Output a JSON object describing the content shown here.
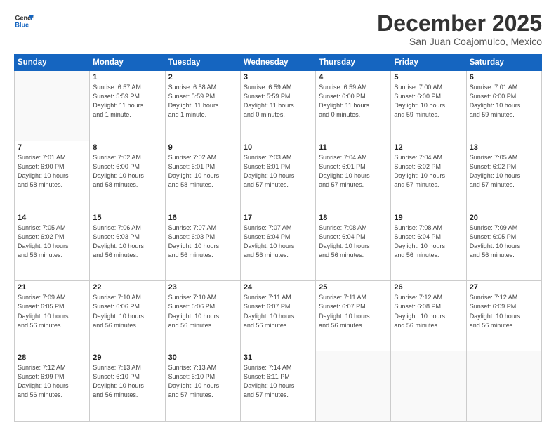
{
  "logo": {
    "line1": "General",
    "line2": "Blue"
  },
  "title": "December 2025",
  "location": "San Juan Coajomulco, Mexico",
  "days_header": [
    "Sunday",
    "Monday",
    "Tuesday",
    "Wednesday",
    "Thursday",
    "Friday",
    "Saturday"
  ],
  "weeks": [
    [
      {
        "day": "",
        "info": ""
      },
      {
        "day": "1",
        "info": "Sunrise: 6:57 AM\nSunset: 5:59 PM\nDaylight: 11 hours\nand 1 minute."
      },
      {
        "day": "2",
        "info": "Sunrise: 6:58 AM\nSunset: 5:59 PM\nDaylight: 11 hours\nand 1 minute."
      },
      {
        "day": "3",
        "info": "Sunrise: 6:59 AM\nSunset: 5:59 PM\nDaylight: 11 hours\nand 0 minutes."
      },
      {
        "day": "4",
        "info": "Sunrise: 6:59 AM\nSunset: 6:00 PM\nDaylight: 11 hours\nand 0 minutes."
      },
      {
        "day": "5",
        "info": "Sunrise: 7:00 AM\nSunset: 6:00 PM\nDaylight: 10 hours\nand 59 minutes."
      },
      {
        "day": "6",
        "info": "Sunrise: 7:01 AM\nSunset: 6:00 PM\nDaylight: 10 hours\nand 59 minutes."
      }
    ],
    [
      {
        "day": "7",
        "info": "Sunrise: 7:01 AM\nSunset: 6:00 PM\nDaylight: 10 hours\nand 58 minutes."
      },
      {
        "day": "8",
        "info": "Sunrise: 7:02 AM\nSunset: 6:00 PM\nDaylight: 10 hours\nand 58 minutes."
      },
      {
        "day": "9",
        "info": "Sunrise: 7:02 AM\nSunset: 6:01 PM\nDaylight: 10 hours\nand 58 minutes."
      },
      {
        "day": "10",
        "info": "Sunrise: 7:03 AM\nSunset: 6:01 PM\nDaylight: 10 hours\nand 57 minutes."
      },
      {
        "day": "11",
        "info": "Sunrise: 7:04 AM\nSunset: 6:01 PM\nDaylight: 10 hours\nand 57 minutes."
      },
      {
        "day": "12",
        "info": "Sunrise: 7:04 AM\nSunset: 6:02 PM\nDaylight: 10 hours\nand 57 minutes."
      },
      {
        "day": "13",
        "info": "Sunrise: 7:05 AM\nSunset: 6:02 PM\nDaylight: 10 hours\nand 57 minutes."
      }
    ],
    [
      {
        "day": "14",
        "info": "Sunrise: 7:05 AM\nSunset: 6:02 PM\nDaylight: 10 hours\nand 56 minutes."
      },
      {
        "day": "15",
        "info": "Sunrise: 7:06 AM\nSunset: 6:03 PM\nDaylight: 10 hours\nand 56 minutes."
      },
      {
        "day": "16",
        "info": "Sunrise: 7:07 AM\nSunset: 6:03 PM\nDaylight: 10 hours\nand 56 minutes."
      },
      {
        "day": "17",
        "info": "Sunrise: 7:07 AM\nSunset: 6:04 PM\nDaylight: 10 hours\nand 56 minutes."
      },
      {
        "day": "18",
        "info": "Sunrise: 7:08 AM\nSunset: 6:04 PM\nDaylight: 10 hours\nand 56 minutes."
      },
      {
        "day": "19",
        "info": "Sunrise: 7:08 AM\nSunset: 6:04 PM\nDaylight: 10 hours\nand 56 minutes."
      },
      {
        "day": "20",
        "info": "Sunrise: 7:09 AM\nSunset: 6:05 PM\nDaylight: 10 hours\nand 56 minutes."
      }
    ],
    [
      {
        "day": "21",
        "info": "Sunrise: 7:09 AM\nSunset: 6:05 PM\nDaylight: 10 hours\nand 56 minutes."
      },
      {
        "day": "22",
        "info": "Sunrise: 7:10 AM\nSunset: 6:06 PM\nDaylight: 10 hours\nand 56 minutes."
      },
      {
        "day": "23",
        "info": "Sunrise: 7:10 AM\nSunset: 6:06 PM\nDaylight: 10 hours\nand 56 minutes."
      },
      {
        "day": "24",
        "info": "Sunrise: 7:11 AM\nSunset: 6:07 PM\nDaylight: 10 hours\nand 56 minutes."
      },
      {
        "day": "25",
        "info": "Sunrise: 7:11 AM\nSunset: 6:07 PM\nDaylight: 10 hours\nand 56 minutes."
      },
      {
        "day": "26",
        "info": "Sunrise: 7:12 AM\nSunset: 6:08 PM\nDaylight: 10 hours\nand 56 minutes."
      },
      {
        "day": "27",
        "info": "Sunrise: 7:12 AM\nSunset: 6:09 PM\nDaylight: 10 hours\nand 56 minutes."
      }
    ],
    [
      {
        "day": "28",
        "info": "Sunrise: 7:12 AM\nSunset: 6:09 PM\nDaylight: 10 hours\nand 56 minutes."
      },
      {
        "day": "29",
        "info": "Sunrise: 7:13 AM\nSunset: 6:10 PM\nDaylight: 10 hours\nand 56 minutes."
      },
      {
        "day": "30",
        "info": "Sunrise: 7:13 AM\nSunset: 6:10 PM\nDaylight: 10 hours\nand 57 minutes."
      },
      {
        "day": "31",
        "info": "Sunrise: 7:14 AM\nSunset: 6:11 PM\nDaylight: 10 hours\nand 57 minutes."
      },
      {
        "day": "",
        "info": ""
      },
      {
        "day": "",
        "info": ""
      },
      {
        "day": "",
        "info": ""
      }
    ]
  ]
}
